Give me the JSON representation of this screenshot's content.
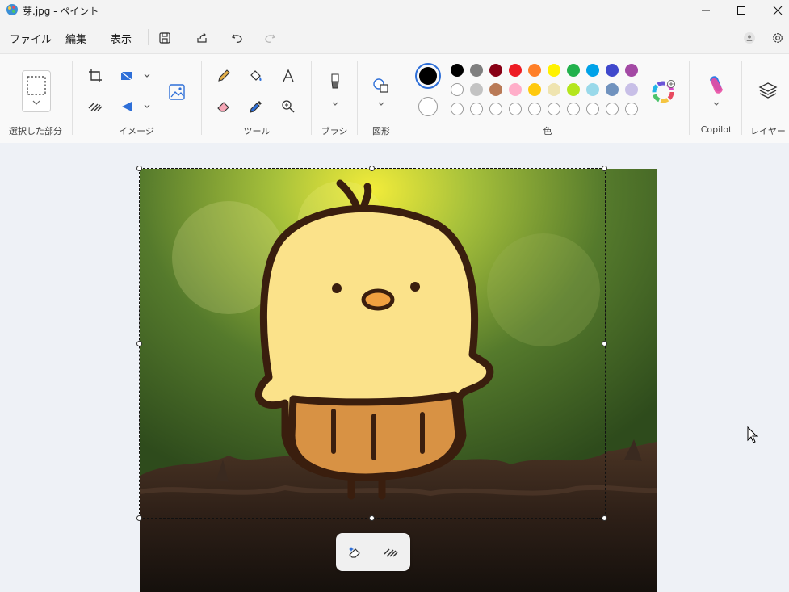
{
  "window": {
    "title": "芽.jpg - ペイント"
  },
  "menu": {
    "file": "ファイル",
    "edit": "編集",
    "view": "表示"
  },
  "ribbon": {
    "groups": {
      "selection": "選択した部分",
      "image": "イメージ",
      "tools": "ツール",
      "brush": "ブラシ",
      "shapes": "図形",
      "colors": "色",
      "copilot": "Copilot",
      "layers": "レイヤー"
    },
    "colors": {
      "primary": "#000000",
      "secondary": "#ffffff",
      "row1": [
        "#000000",
        "#7f7f7f",
        "#880015",
        "#ed1c24",
        "#ff7f27",
        "#fff200",
        "#22b14c",
        "#00a2e8",
        "#3f48cc",
        "#a349a4"
      ],
      "row2": [
        "#ffffff",
        "#c3c3c3",
        "#b97a57",
        "#ffaec9",
        "#ffc90e",
        "#efe4b0",
        "#b5e61d",
        "#99d9ea",
        "#7092be",
        "#c8bfe7"
      ],
      "row3": [
        "empty",
        "empty",
        "empty",
        "empty",
        "empty",
        "empty",
        "empty",
        "empty",
        "empty",
        "empty"
      ]
    }
  }
}
